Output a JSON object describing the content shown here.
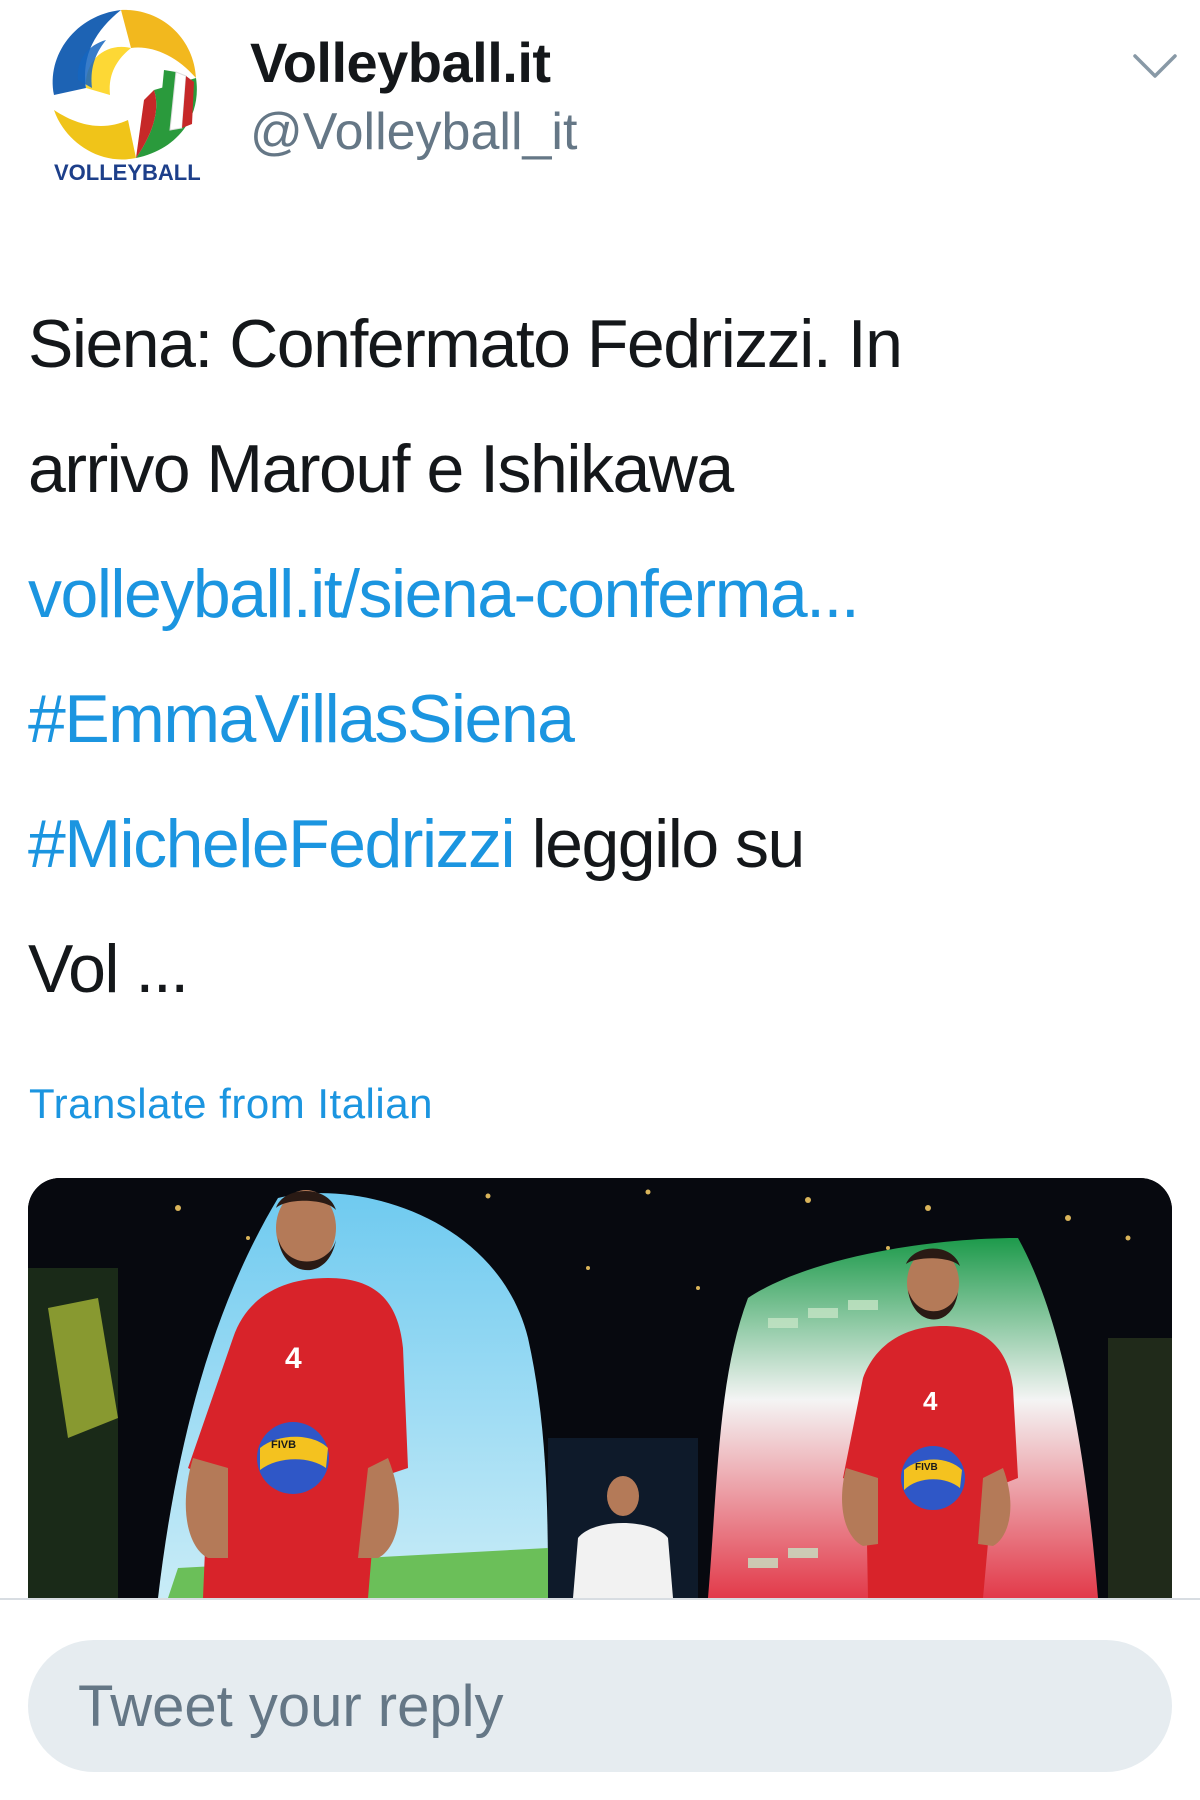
{
  "tweet": {
    "author": {
      "display_name": "Volleyball.it",
      "handle": "@Volleyball_it",
      "avatar_icon": "volleyball-it-logo",
      "avatar_text": "VOLLEYBALL"
    },
    "menu_icon": "chevron-down-icon",
    "text_lines": [
      [
        {
          "text": "Siena: Confermato Fedrizzi. In",
          "link": false
        }
      ],
      [
        {
          "text": "arrivo Marouf e Ishikawa",
          "link": false
        }
      ],
      [
        {
          "text": "volleyball.it/siena-conferma...",
          "link": true
        }
      ],
      [
        {
          "text": "#EmmaVillasSiena",
          "link": true
        }
      ],
      [
        {
          "text": "#MicheleFedrizzi",
          "link": true
        },
        {
          "text": " leggilo su",
          "link": false
        }
      ],
      [
        {
          "text": "Vol ...",
          "link": false
        }
      ]
    ],
    "translate_label": "Translate from Italian",
    "media": {
      "description_icon": "photo-volleyball-player-screens",
      "jersey_number": "4",
      "ball_label": "FIVB"
    }
  },
  "reply": {
    "placeholder": "Tweet your reply"
  },
  "colors": {
    "link": "#1b95e0",
    "text": "#14171a",
    "secondary": "#657786",
    "reply_bg": "#e6ecf0"
  }
}
